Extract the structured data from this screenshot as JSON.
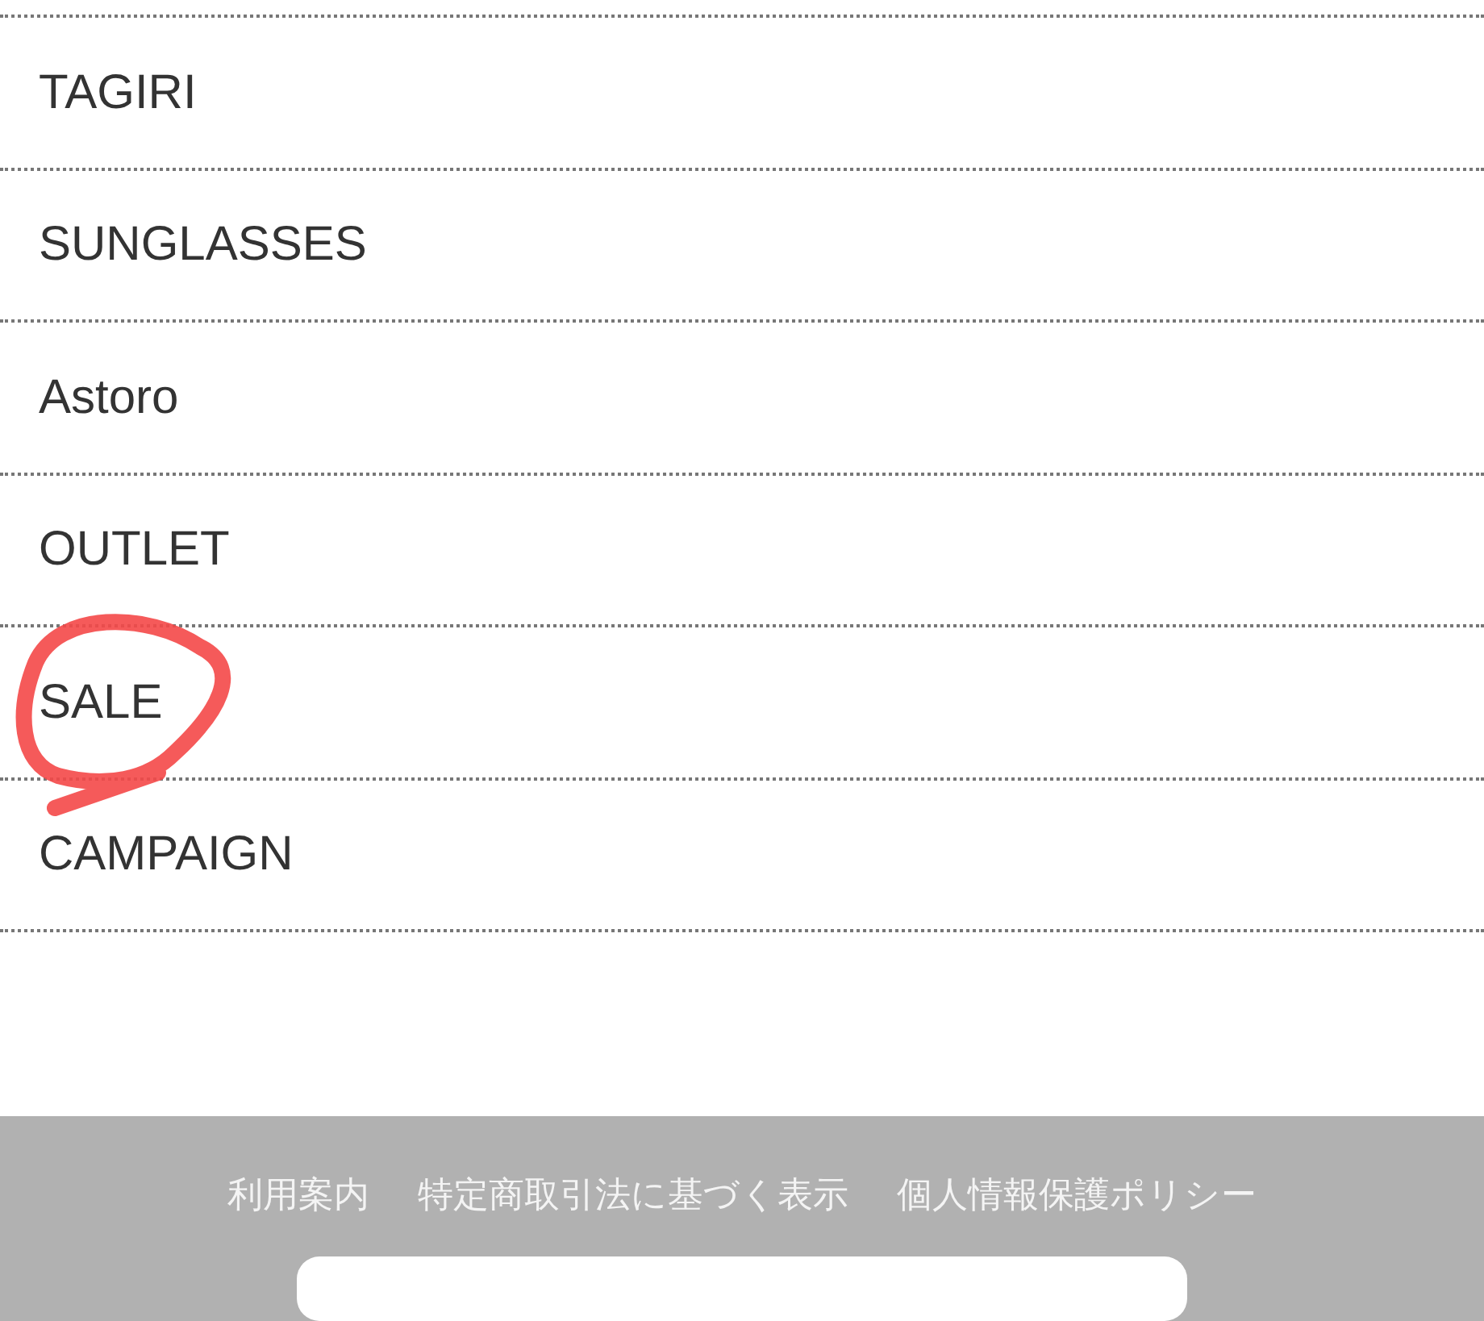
{
  "menu": [
    {
      "label": "TAGIRI",
      "circled": false
    },
    {
      "label": "SUNGLASSES",
      "circled": false
    },
    {
      "label": "Astoro",
      "circled": false
    },
    {
      "label": "OUTLET",
      "circled": false
    },
    {
      "label": "SALE",
      "circled": true
    },
    {
      "label": "CAMPAIGN",
      "circled": false
    }
  ],
  "footer": {
    "links": [
      "利用案内",
      "特定商取引法に基づく表示",
      "個人情報保護ポリシー"
    ]
  }
}
